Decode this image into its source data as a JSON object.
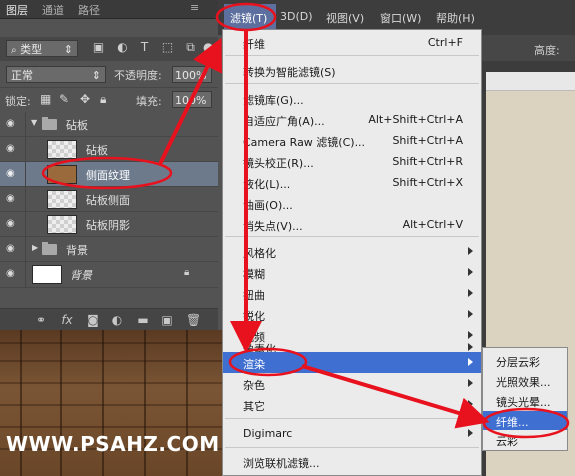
{
  "panel": {
    "tabs": [
      "图层",
      "通道",
      "路径"
    ],
    "filter_kind": "类型",
    "blend_mode": "正常",
    "opacity_label": "不透明度:",
    "opacity_value": "100%",
    "lock_label": "锁定:",
    "fill_label": "填充:",
    "fill_value": "100%",
    "layers": [
      {
        "name": "砧板",
        "type": "group"
      },
      {
        "name": "砧板",
        "type": "layer"
      },
      {
        "name": "侧面纹理",
        "type": "layer",
        "selected": true
      },
      {
        "name": "砧板侧面",
        "type": "layer"
      },
      {
        "name": "砧板阴影",
        "type": "layer"
      },
      {
        "name": "背景",
        "type": "group"
      },
      {
        "name": "背景",
        "type": "background"
      }
    ],
    "footer_icons": [
      "link-icon",
      "fx-icon",
      "mask-icon",
      "adjustment-icon",
      "folder-icon",
      "new-layer-icon",
      "trash-icon"
    ]
  },
  "menubar": {
    "items": [
      "滤镜(T)",
      "3D(D)",
      "视图(V)",
      "窗口(W)",
      "帮助(H)"
    ]
  },
  "options_bar_fragment": "高度:",
  "filter_menu": {
    "items": [
      {
        "label": "纤维",
        "shortcut": "Ctrl+F"
      },
      {
        "label": "转换为智能滤镜(S)",
        "shortcut": ""
      },
      {
        "label": "滤镜库(G)...",
        "shortcut": ""
      },
      {
        "label": "自适应广角(A)...",
        "shortcut": "Alt+Shift+Ctrl+A"
      },
      {
        "label": "Camera Raw 滤镜(C)...",
        "shortcut": "Shift+Ctrl+A"
      },
      {
        "label": "镜头校正(R)...",
        "shortcut": "Shift+Ctrl+R"
      },
      {
        "label": "液化(L)...",
        "shortcut": "Shift+Ctrl+X"
      },
      {
        "label": "油画(O)...",
        "shortcut": ""
      },
      {
        "label": "消失点(V)...",
        "shortcut": "Alt+Ctrl+V"
      },
      {
        "label": "风格化",
        "shortcut": ""
      },
      {
        "label": "模糊",
        "shortcut": ""
      },
      {
        "label": "扭曲",
        "shortcut": ""
      },
      {
        "label": "锐化",
        "shortcut": ""
      },
      {
        "label": "视频",
        "shortcut": ""
      },
      {
        "label": "像素化",
        "shortcut": ""
      },
      {
        "label": "渲染",
        "shortcut": ""
      },
      {
        "label": "杂色",
        "shortcut": ""
      },
      {
        "label": "其它",
        "shortcut": ""
      },
      {
        "label": "Digimarc",
        "shortcut": ""
      },
      {
        "label": "浏览联机滤镜...",
        "shortcut": ""
      }
    ]
  },
  "render_submenu": {
    "items": [
      "分层云彩",
      "光照效果...",
      "镜头光晕...",
      "纤维...",
      "云彩"
    ]
  },
  "watermark": "WWW.PSAHZ.COM",
  "colors": {
    "annotation_red": "#e8121e",
    "menu_highlight": "#3f6fd0",
    "selected_layer": "#6d7a8c"
  }
}
